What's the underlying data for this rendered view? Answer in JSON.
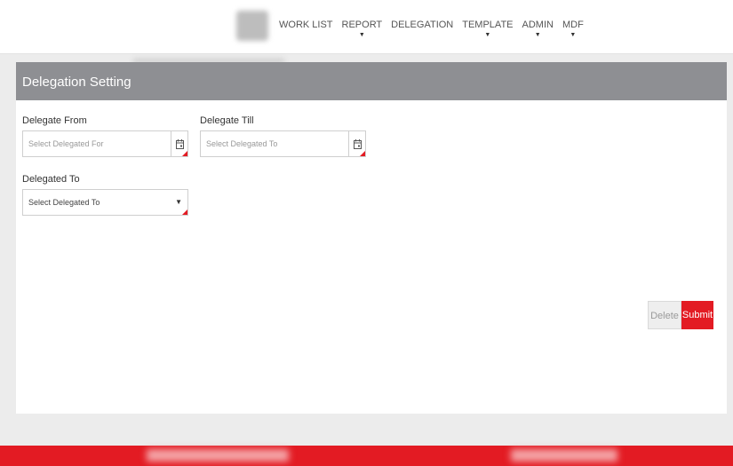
{
  "nav": {
    "items": [
      {
        "label": "WORK LIST",
        "has_caret": false
      },
      {
        "label": "REPORT",
        "has_caret": true
      },
      {
        "label": "DELEGATION",
        "has_caret": false
      },
      {
        "label": "TEMPLATE",
        "has_caret": true
      },
      {
        "label": "ADMIN",
        "has_caret": true
      },
      {
        "label": "MDF",
        "has_caret": true
      }
    ]
  },
  "panel": {
    "title": "Delegation Setting"
  },
  "form": {
    "delegate_from": {
      "label": "Delegate From",
      "placeholder": "Select Delegated For"
    },
    "delegate_till": {
      "label": "Delegate Till",
      "placeholder": "Select Delegated To"
    },
    "delegated_to": {
      "label": "Delegated To",
      "selected": "Select Delegated To"
    }
  },
  "buttons": {
    "delete": "Delete",
    "submit": "Submit"
  },
  "colors": {
    "accent": "#e31b23",
    "header_bg": "#8e8f93"
  }
}
